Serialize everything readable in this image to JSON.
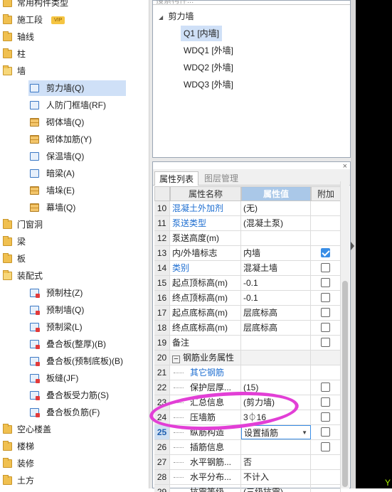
{
  "left_tree": {
    "items": [
      {
        "label": "常用构件类型",
        "level": 0,
        "icon": "folder-icon"
      },
      {
        "label": "施工段",
        "level": 0,
        "icon": "folder-icon",
        "badge": "VIP"
      },
      {
        "label": "轴线",
        "level": 0,
        "icon": "folder-icon"
      },
      {
        "label": "柱",
        "level": 0,
        "icon": "folder-icon"
      },
      {
        "label": "墙",
        "level": 0,
        "icon": "folder-open-icon"
      },
      {
        "label": "剪力墙(Q)",
        "level": 1,
        "icon": "shear-wall-icon",
        "selected": true
      },
      {
        "label": "人防门框墙(RF)",
        "level": 1,
        "icon": "blast-door-wall-icon"
      },
      {
        "label": "砌体墙(Q)",
        "level": 1,
        "icon": "masonry-wall-icon"
      },
      {
        "label": "砌体加筋(Y)",
        "level": 1,
        "icon": "masonry-rebar-icon"
      },
      {
        "label": "保温墙(Q)",
        "level": 1,
        "icon": "insulation-wall-icon"
      },
      {
        "label": "暗梁(A)",
        "level": 1,
        "icon": "hidden-beam-icon"
      },
      {
        "label": "墙垛(E)",
        "level": 1,
        "icon": "wall-pier-icon"
      },
      {
        "label": "幕墙(Q)",
        "level": 1,
        "icon": "curtain-wall-icon"
      },
      {
        "label": "门窗洞",
        "level": 0,
        "icon": "folder-icon"
      },
      {
        "label": "梁",
        "level": 0,
        "icon": "folder-icon"
      },
      {
        "label": "板",
        "level": 0,
        "icon": "folder-icon"
      },
      {
        "label": "装配式",
        "level": 0,
        "icon": "folder-open-icon"
      },
      {
        "label": "预制柱(Z)",
        "level": 1,
        "icon": "precast-column-icon"
      },
      {
        "label": "预制墙(Q)",
        "level": 1,
        "icon": "precast-wall-icon"
      },
      {
        "label": "预制梁(L)",
        "level": 1,
        "icon": "precast-beam-icon"
      },
      {
        "label": "叠合板(整厚)(B)",
        "level": 1,
        "icon": "composite-slab-icon"
      },
      {
        "label": "叠合板(预制底板)(B)",
        "level": 1,
        "icon": "composite-slab-base-icon"
      },
      {
        "label": "板缝(JF)",
        "level": 1,
        "icon": "slab-joint-icon"
      },
      {
        "label": "叠合板受力筋(S)",
        "level": 1,
        "icon": "slab-main-rebar-icon"
      },
      {
        "label": "叠合板负筋(F)",
        "level": 1,
        "icon": "slab-negative-rebar-icon"
      },
      {
        "label": "空心楼盖",
        "level": 0,
        "icon": "folder-icon"
      },
      {
        "label": "楼梯",
        "level": 0,
        "icon": "folder-icon"
      },
      {
        "label": "装修",
        "level": 0,
        "icon": "folder-icon"
      },
      {
        "label": "土方",
        "level": 0,
        "icon": "folder-icon"
      }
    ]
  },
  "component_list": {
    "search_placeholder": "搜索构件...",
    "group": "剪力墙",
    "items": [
      {
        "label": "Q1 [内墙]",
        "selected": true
      },
      {
        "label": "WDQ1 [外墙]"
      },
      {
        "label": "WDQ2 [外墙]"
      },
      {
        "label": "WDQ3 [外墙]"
      }
    ]
  },
  "props": {
    "tab_active": "属性列表",
    "tab_inactive": "图层管理",
    "close": "×",
    "headers": {
      "name": "属性名称",
      "value": "属性值",
      "extra": "附加"
    },
    "rows": [
      {
        "no": "10",
        "name": "混凝土外加剂",
        "value": "(无)",
        "link": true,
        "cb": null
      },
      {
        "no": "11",
        "name": "泵送类型",
        "value": "(混凝土泵)",
        "link": true,
        "cb": null
      },
      {
        "no": "12",
        "name": "泵送高度(m)",
        "value": "",
        "link": false,
        "cb": null
      },
      {
        "no": "13",
        "name": "内/外墙标志",
        "value": "内墙",
        "link": false,
        "cb": true
      },
      {
        "no": "14",
        "name": "类别",
        "value": "混凝土墙",
        "link": true,
        "cb": false
      },
      {
        "no": "15",
        "name": "起点顶标高(m)",
        "value": "-0.1",
        "link": false,
        "cb": false
      },
      {
        "no": "16",
        "name": "终点顶标高(m)",
        "value": "-0.1",
        "link": false,
        "cb": false
      },
      {
        "no": "17",
        "name": "起点底标高(m)",
        "value": "层底标高",
        "link": false,
        "cb": false
      },
      {
        "no": "18",
        "name": "终点底标高(m)",
        "value": "层底标高",
        "link": false,
        "cb": false
      },
      {
        "no": "19",
        "name": "备注",
        "value": "",
        "link": false,
        "cb": false
      },
      {
        "no": "20",
        "name": "钢筋业务属性",
        "value": "",
        "link": false,
        "cb": null,
        "group": true
      },
      {
        "no": "21",
        "name": "其它钢筋",
        "value": "",
        "link": true,
        "cb": null,
        "child": true
      },
      {
        "no": "22",
        "name": "保护层厚...",
        "value": "(15)",
        "link": false,
        "cb": false,
        "child": true
      },
      {
        "no": "23",
        "name": "汇总信息",
        "value": "(剪力墙)",
        "link": false,
        "cb": false,
        "child": true
      },
      {
        "no": "24",
        "name": "压墙筋",
        "value": "3⏀16",
        "link": false,
        "cb": false,
        "child": true
      },
      {
        "no": "25",
        "name": "纵筋构造",
        "value": "设置插筋",
        "link": false,
        "cb": false,
        "child": true,
        "active": true
      },
      {
        "no": "26",
        "name": "插筋信息",
        "value": "",
        "link": false,
        "cb": false,
        "child": true
      },
      {
        "no": "27",
        "name": "水平钢筋...",
        "value": "否",
        "link": false,
        "cb": null,
        "child": true
      },
      {
        "no": "28",
        "name": "水平分布...",
        "value": "不计入",
        "link": false,
        "cb": null,
        "child": true
      },
      {
        "no": "29",
        "name": "抗震等级",
        "value": "(三级抗震)",
        "link": false,
        "cb": null,
        "child": true
      }
    ]
  },
  "corner_text": "Y",
  "colors": {
    "link": "#1f6fd1",
    "header_highlight": "#aac8e8",
    "annotation": "#e23fd6"
  }
}
